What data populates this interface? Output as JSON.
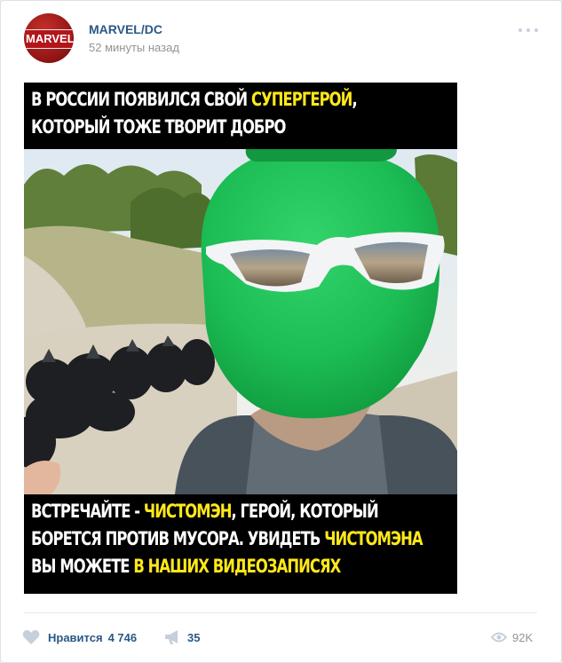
{
  "post": {
    "author": "MARVEL/DC",
    "avatar_text": "MARVEL",
    "time": "52 минуты назад",
    "image": {
      "top_line1_a": "В РОССИИ ПОЯВИЛСЯ СВОЙ ",
      "top_line1_b": "СУПЕРГЕРОЙ",
      "top_line1_c": ",",
      "top_line2": "КОТОРЫЙ ТОЖЕ ТВОРИТ ДОБРО",
      "bottom_line1_a": "ВСТРЕЧАЙТЕ - ",
      "bottom_line1_b": "ЧИСТОМЭН",
      "bottom_line1_c": ", ГЕРОЙ, КОТОРЫЙ",
      "bottom_line2_a": "БОРЕТСЯ ПРОТИВ МУСОРА. УВИДЕТЬ ",
      "bottom_line2_b": "ЧИСТОМЭНА",
      "bottom_line3_a": "ВЫ МОЖЕТЕ ",
      "bottom_line3_b": "В НАШИХ ВИДЕОЗАПИСЯХ"
    },
    "footer": {
      "like_label": "Нравится",
      "like_count": "4 746",
      "share_count": "35",
      "views_count": "92K"
    }
  },
  "colors": {
    "link": "#2a5885",
    "highlight": "#ffe81a",
    "mask_green": "#1fc45a",
    "icon_gray": "#c5d0db"
  },
  "icons": [
    "heart-icon",
    "megaphone-icon",
    "eye-icon",
    "more-icon"
  ]
}
